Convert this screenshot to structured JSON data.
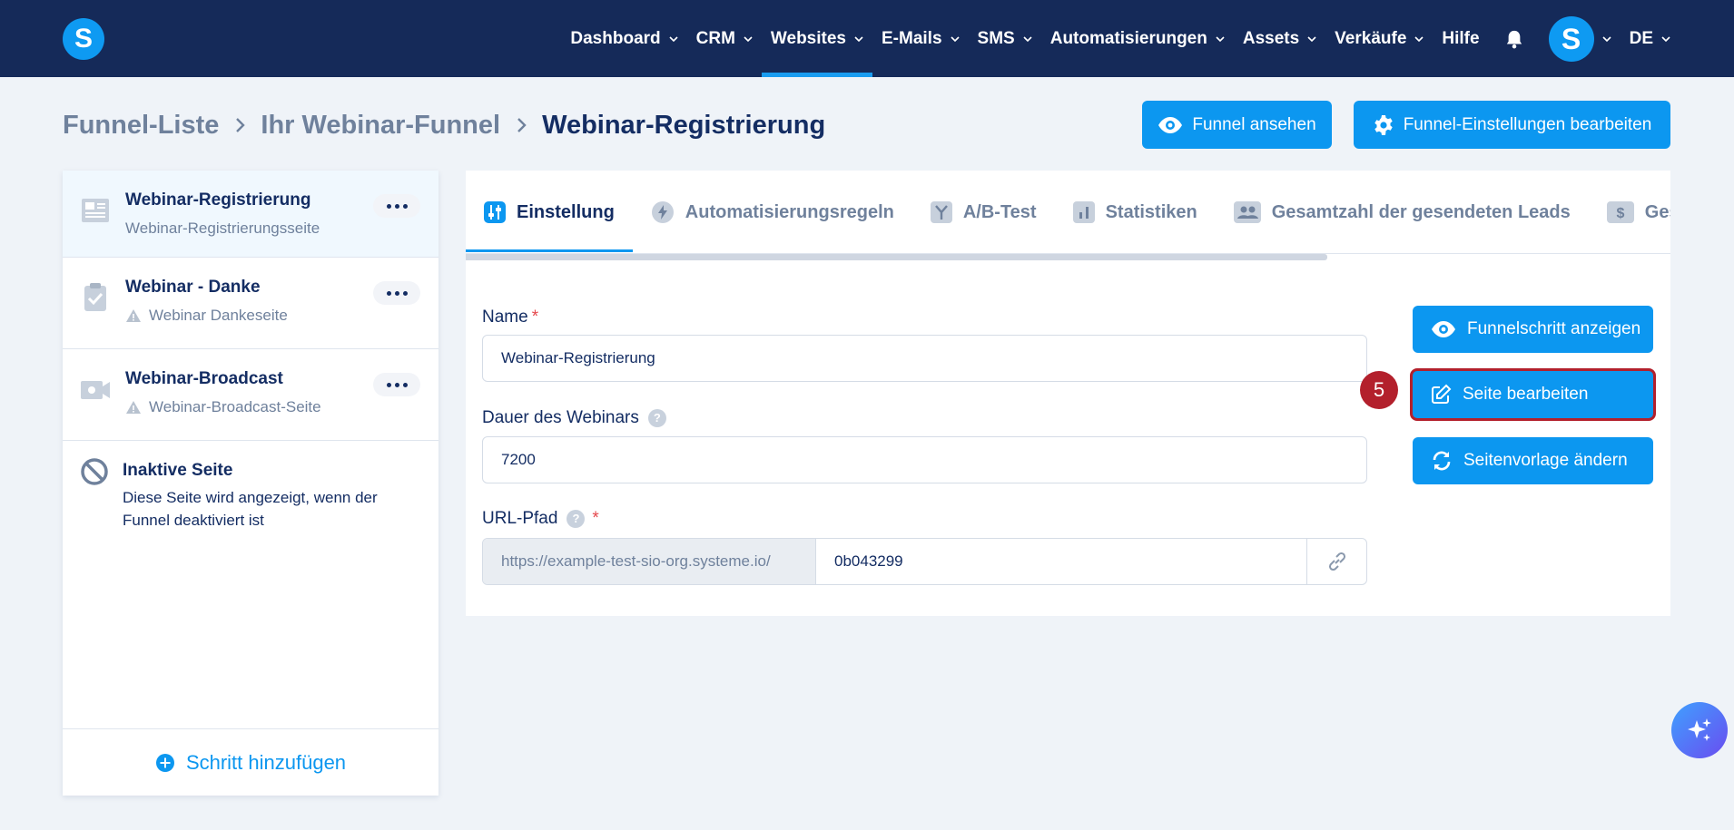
{
  "app": {
    "logo_letter": "S",
    "accent": "#0c97f0",
    "nav_bg": "#152a59"
  },
  "nav": {
    "items": [
      {
        "label": "Dashboard",
        "dropdown": true
      },
      {
        "label": "CRM",
        "dropdown": true
      },
      {
        "label": "Websites",
        "dropdown": true,
        "active": true
      },
      {
        "label": "E-Mails",
        "dropdown": true
      },
      {
        "label": "SMS",
        "dropdown": true
      },
      {
        "label": "Automatisierungen",
        "dropdown": true
      },
      {
        "label": "Assets",
        "dropdown": true
      },
      {
        "label": "Verkäufe",
        "dropdown": true
      },
      {
        "label": "Hilfe",
        "dropdown": false
      }
    ],
    "avatar_letter": "S",
    "language": "DE"
  },
  "breadcrumb": {
    "items": [
      "Funnel-Liste",
      "Ihr Webinar-Funnel",
      "Webinar-Registrierung"
    ]
  },
  "header_buttons": {
    "view_funnel": "Funnel ansehen",
    "edit_settings": "Funnel-Einstellungen bearbeiten"
  },
  "sidebar": {
    "steps": [
      {
        "title": "Webinar-Registrierung",
        "subtitle": "Webinar-Registrierungsseite",
        "warning": false,
        "icon": "page-icon"
      },
      {
        "title": "Webinar - Danke",
        "subtitle": "Webinar Dankeseite",
        "warning": true,
        "icon": "clipboard-check-icon"
      },
      {
        "title": "Webinar-Broadcast",
        "subtitle": "Webinar-Broadcast-Seite",
        "warning": true,
        "icon": "video-camera-icon"
      }
    ],
    "inactive": {
      "title": "Inaktive Seite",
      "description": "Diese Seite wird angezeigt, wenn der Funnel deaktiviert ist"
    },
    "add_step": "Schritt hinzufügen"
  },
  "tabs": [
    {
      "label": "Einstellung",
      "icon": "sliders-icon",
      "active": true
    },
    {
      "label": "Automatisierungsregeln",
      "icon": "bolt-icon"
    },
    {
      "label": "A/B-Test",
      "icon": "split-icon"
    },
    {
      "label": "Statistiken",
      "icon": "bar-chart-icon"
    },
    {
      "label": "Gesamtzahl der gesendeten Leads",
      "icon": "users-icon"
    },
    {
      "label": "Gesa",
      "icon": "dollar-icon"
    }
  ],
  "form": {
    "name_label": "Name",
    "name_value": "Webinar-Registrierung",
    "duration_label": "Dauer des Webinars",
    "duration_value": "7200",
    "url_label": "URL-Pfad",
    "url_prefix": "https://example-test-sio-org.systeme.io/",
    "url_value": "0b043299",
    "required_mark": "*",
    "help_mark": "?"
  },
  "actions": {
    "show_step": "Funnelschritt anzeigen",
    "edit_page": "Seite bearbeiten",
    "change_template": "Seitenvorlage ändern"
  },
  "annotation": {
    "step_number": "5",
    "color": "#b3202c"
  }
}
